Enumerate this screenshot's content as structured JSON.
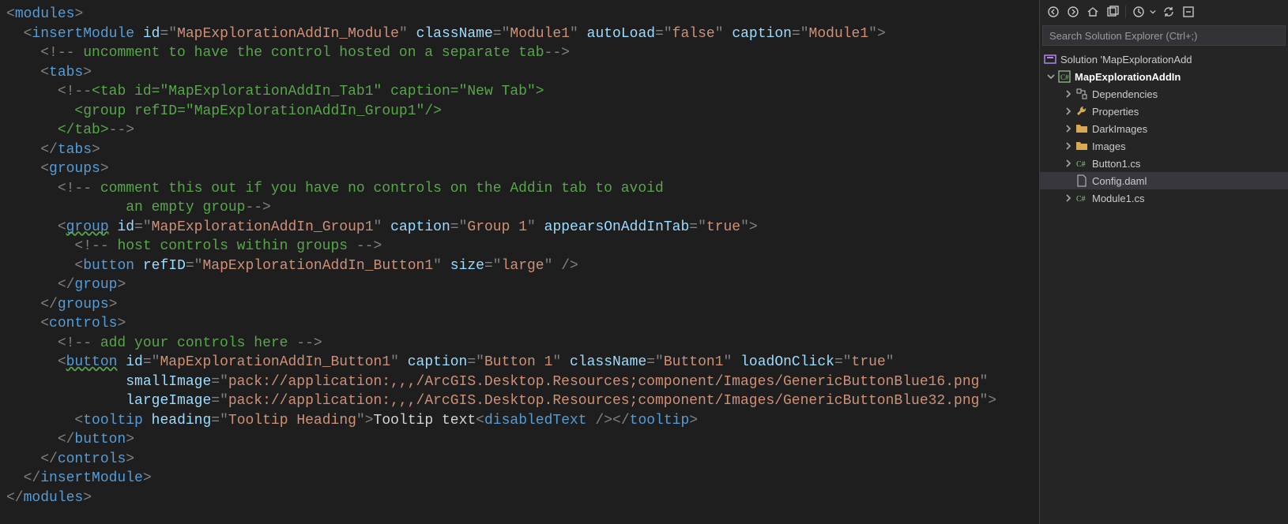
{
  "code": {
    "l1": {
      "tag": "modules"
    },
    "l2": {
      "tag": "insertModule",
      "a1": "id",
      "v1": "MapExplorationAddIn_Module",
      "a2": "className",
      "v2": "Module1",
      "a3": "autoLoad",
      "v3": "false",
      "a4": "caption",
      "v4": "Module1"
    },
    "l3": {
      "cmt": " uncomment to have the control hosted on a separate tab"
    },
    "l4": {
      "tag": "tabs"
    },
    "l5a": {
      "tag": "tab",
      "a1": "id",
      "v1": "MapExplorationAddIn_Tab1",
      "a2": "caption",
      "v2": "New Tab"
    },
    "l6": {
      "tag": "group",
      "a1": "refID",
      "v1": "MapExplorationAddIn_Group1"
    },
    "l7": {
      "tag": "tab"
    },
    "l8": {
      "tag": "tabs"
    },
    "l9": {
      "tag": "groups"
    },
    "l10a": " comment this out if you have no controls on the Addin tab to avoid",
    "l10b": "              an empty group",
    "l11": {
      "tag": "group",
      "a1": "id",
      "v1": "MapExplorationAddIn_Group1",
      "a2": "caption",
      "v2": "Group 1",
      "a3": "appearsOnAddInTab",
      "v3": "true"
    },
    "l12": " host controls within groups ",
    "l13": {
      "tag": "button",
      "a1": "refID",
      "v1": "MapExplorationAddIn_Button1",
      "a2": "size",
      "v2": "large"
    },
    "l14": {
      "tag": "group"
    },
    "l15": {
      "tag": "groups"
    },
    "l16": {
      "tag": "controls"
    },
    "l17": " add your controls here ",
    "l18": {
      "tag": "button",
      "a1": "id",
      "v1": "MapExplorationAddIn_Button1",
      "a2": "caption",
      "v2": "Button 1",
      "a3": "className",
      "v3": "Button1",
      "a4": "loadOnClick",
      "v4": "true"
    },
    "l19": {
      "a1": "smallImage",
      "v1": "pack://application:,,,/ArcGIS.Desktop.Resources;component/Images/GenericButtonBlue16.png"
    },
    "l20": {
      "a1": "largeImage",
      "v1": "pack://application:,,,/ArcGIS.Desktop.Resources;component/Images/GenericButtonBlue32.png"
    },
    "l21": {
      "tag1": "tooltip",
      "a1": "heading",
      "v1": "Tooltip Heading",
      "txt": "Tooltip text",
      "tag2": "disabledText",
      "tag3": "tooltip"
    },
    "l22": {
      "tag": "button"
    },
    "l23": {
      "tag": "controls"
    },
    "l24": {
      "tag": "insertModule"
    },
    "l25": {
      "tag": "modules"
    }
  },
  "search": {
    "placeholder": "Search Solution Explorer (Ctrl+;)"
  },
  "tree": {
    "t0": "Solution 'MapExplorationAdd",
    "t1": "MapExplorationAddIn",
    "t2": "Dependencies",
    "t3": "Properties",
    "t4": "DarkImages",
    "t5": "Images",
    "t6": "Button1.cs",
    "t7": "Config.daml",
    "t8": "Module1.cs"
  }
}
